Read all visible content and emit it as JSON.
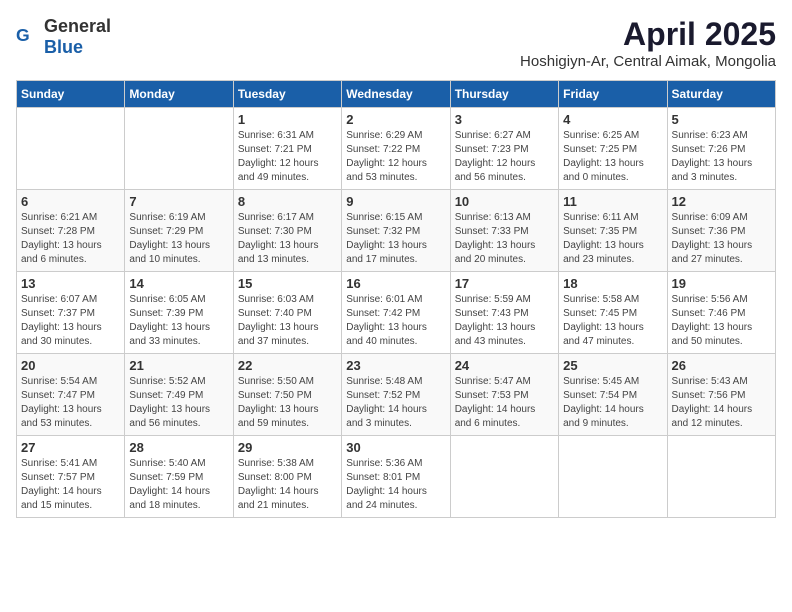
{
  "header": {
    "logo_general": "General",
    "logo_blue": "Blue",
    "title": "April 2025",
    "subtitle": "Hoshigiyn-Ar, Central Aimak, Mongolia"
  },
  "columns": [
    "Sunday",
    "Monday",
    "Tuesday",
    "Wednesday",
    "Thursday",
    "Friday",
    "Saturday"
  ],
  "weeks": [
    [
      {
        "day": "",
        "detail": ""
      },
      {
        "day": "",
        "detail": ""
      },
      {
        "day": "1",
        "detail": "Sunrise: 6:31 AM\nSunset: 7:21 PM\nDaylight: 12 hours\nand 49 minutes."
      },
      {
        "day": "2",
        "detail": "Sunrise: 6:29 AM\nSunset: 7:22 PM\nDaylight: 12 hours\nand 53 minutes."
      },
      {
        "day": "3",
        "detail": "Sunrise: 6:27 AM\nSunset: 7:23 PM\nDaylight: 12 hours\nand 56 minutes."
      },
      {
        "day": "4",
        "detail": "Sunrise: 6:25 AM\nSunset: 7:25 PM\nDaylight: 13 hours\nand 0 minutes."
      },
      {
        "day": "5",
        "detail": "Sunrise: 6:23 AM\nSunset: 7:26 PM\nDaylight: 13 hours\nand 3 minutes."
      }
    ],
    [
      {
        "day": "6",
        "detail": "Sunrise: 6:21 AM\nSunset: 7:28 PM\nDaylight: 13 hours\nand 6 minutes."
      },
      {
        "day": "7",
        "detail": "Sunrise: 6:19 AM\nSunset: 7:29 PM\nDaylight: 13 hours\nand 10 minutes."
      },
      {
        "day": "8",
        "detail": "Sunrise: 6:17 AM\nSunset: 7:30 PM\nDaylight: 13 hours\nand 13 minutes."
      },
      {
        "day": "9",
        "detail": "Sunrise: 6:15 AM\nSunset: 7:32 PM\nDaylight: 13 hours\nand 17 minutes."
      },
      {
        "day": "10",
        "detail": "Sunrise: 6:13 AM\nSunset: 7:33 PM\nDaylight: 13 hours\nand 20 minutes."
      },
      {
        "day": "11",
        "detail": "Sunrise: 6:11 AM\nSunset: 7:35 PM\nDaylight: 13 hours\nand 23 minutes."
      },
      {
        "day": "12",
        "detail": "Sunrise: 6:09 AM\nSunset: 7:36 PM\nDaylight: 13 hours\nand 27 minutes."
      }
    ],
    [
      {
        "day": "13",
        "detail": "Sunrise: 6:07 AM\nSunset: 7:37 PM\nDaylight: 13 hours\nand 30 minutes."
      },
      {
        "day": "14",
        "detail": "Sunrise: 6:05 AM\nSunset: 7:39 PM\nDaylight: 13 hours\nand 33 minutes."
      },
      {
        "day": "15",
        "detail": "Sunrise: 6:03 AM\nSunset: 7:40 PM\nDaylight: 13 hours\nand 37 minutes."
      },
      {
        "day": "16",
        "detail": "Sunrise: 6:01 AM\nSunset: 7:42 PM\nDaylight: 13 hours\nand 40 minutes."
      },
      {
        "day": "17",
        "detail": "Sunrise: 5:59 AM\nSunset: 7:43 PM\nDaylight: 13 hours\nand 43 minutes."
      },
      {
        "day": "18",
        "detail": "Sunrise: 5:58 AM\nSunset: 7:45 PM\nDaylight: 13 hours\nand 47 minutes."
      },
      {
        "day": "19",
        "detail": "Sunrise: 5:56 AM\nSunset: 7:46 PM\nDaylight: 13 hours\nand 50 minutes."
      }
    ],
    [
      {
        "day": "20",
        "detail": "Sunrise: 5:54 AM\nSunset: 7:47 PM\nDaylight: 13 hours\nand 53 minutes."
      },
      {
        "day": "21",
        "detail": "Sunrise: 5:52 AM\nSunset: 7:49 PM\nDaylight: 13 hours\nand 56 minutes."
      },
      {
        "day": "22",
        "detail": "Sunrise: 5:50 AM\nSunset: 7:50 PM\nDaylight: 13 hours\nand 59 minutes."
      },
      {
        "day": "23",
        "detail": "Sunrise: 5:48 AM\nSunset: 7:52 PM\nDaylight: 14 hours\nand 3 minutes."
      },
      {
        "day": "24",
        "detail": "Sunrise: 5:47 AM\nSunset: 7:53 PM\nDaylight: 14 hours\nand 6 minutes."
      },
      {
        "day": "25",
        "detail": "Sunrise: 5:45 AM\nSunset: 7:54 PM\nDaylight: 14 hours\nand 9 minutes."
      },
      {
        "day": "26",
        "detail": "Sunrise: 5:43 AM\nSunset: 7:56 PM\nDaylight: 14 hours\nand 12 minutes."
      }
    ],
    [
      {
        "day": "27",
        "detail": "Sunrise: 5:41 AM\nSunset: 7:57 PM\nDaylight: 14 hours\nand 15 minutes."
      },
      {
        "day": "28",
        "detail": "Sunrise: 5:40 AM\nSunset: 7:59 PM\nDaylight: 14 hours\nand 18 minutes."
      },
      {
        "day": "29",
        "detail": "Sunrise: 5:38 AM\nSunset: 8:00 PM\nDaylight: 14 hours\nand 21 minutes."
      },
      {
        "day": "30",
        "detail": "Sunrise: 5:36 AM\nSunset: 8:01 PM\nDaylight: 14 hours\nand 24 minutes."
      },
      {
        "day": "",
        "detail": ""
      },
      {
        "day": "",
        "detail": ""
      },
      {
        "day": "",
        "detail": ""
      }
    ]
  ]
}
